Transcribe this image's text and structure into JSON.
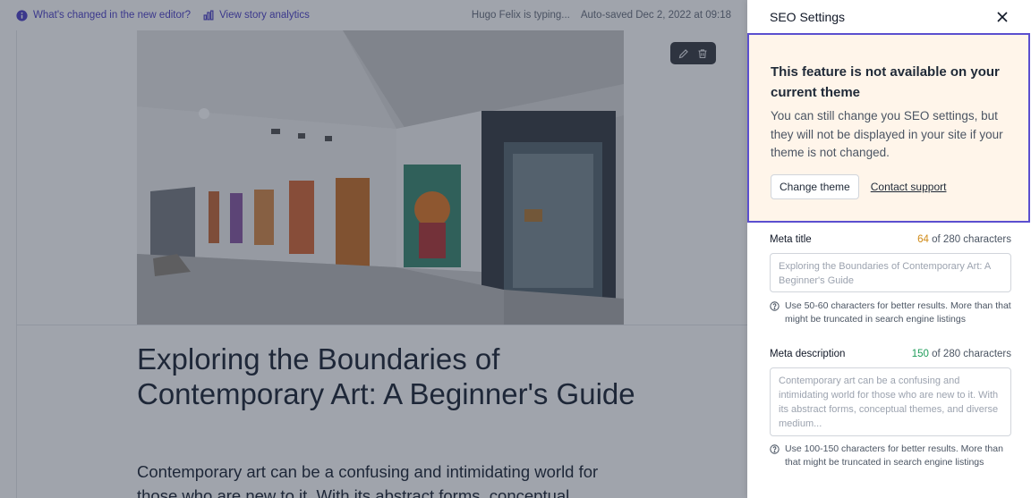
{
  "topbar": {
    "whats_changed": "What's changed in the new editor?",
    "view_analytics": "View story analytics",
    "typing_status": "Hugo Felix is typing...",
    "autosave_status": "Auto-saved Dec 2, 2022 at 09:18"
  },
  "article": {
    "title": "Exploring the Boundaries of Contemporary Art: A Beginner's Guide",
    "body": "Contemporary art can be a confusing and intimidating world for those who are new to it. With its abstract forms, conceptual"
  },
  "panel": {
    "title": "SEO Settings",
    "notice": {
      "title": "This feature is not available on your current theme",
      "text": "You can still change you SEO settings, but they will not be displayed in your site if your theme is not changed.",
      "change_theme": "Change theme",
      "contact_support": "Contact support"
    },
    "meta_title": {
      "label": "Meta title",
      "count": "64",
      "count_suffix": "of 280 characters",
      "value": "Exploring the Boundaries of Contemporary Art: A Beginner's Guide",
      "hint": "Use 50-60 characters for better results. More than that might be truncated in search engine listings"
    },
    "meta_description": {
      "label": "Meta description",
      "count": "150",
      "count_suffix": "of 280 characters",
      "value": "Contemporary art can be a confusing and intimidating world for those who are new to it. With its abstract forms, conceptual themes, and diverse medium...",
      "hint": "Use 100-150 characters for better results. More than that might be truncated in search engine listings"
    }
  },
  "colors": {
    "accent": "#5b4fcf",
    "notice_bg": "#fff5ea",
    "count_warning": "#d08a17",
    "count_ok": "#1f9d5a"
  }
}
